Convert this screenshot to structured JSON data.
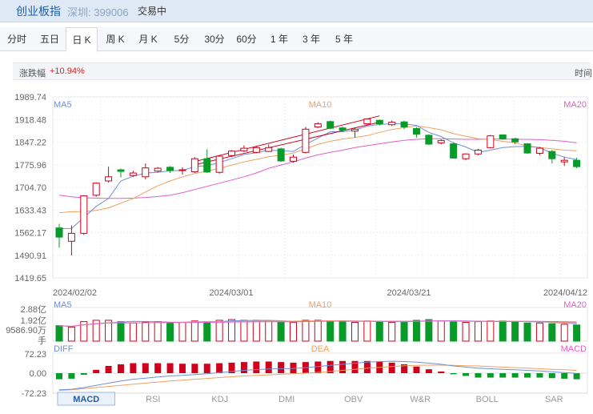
{
  "header": {
    "name": "创业板指",
    "code": "深圳: 399006",
    "status": "交易中"
  },
  "tabs": [
    "分时",
    "五日",
    "日 K",
    "周 K",
    "月 K",
    "5分",
    "30分",
    "60分",
    "1 年",
    "3 年",
    "5 年"
  ],
  "active_tab": "日 K",
  "change": {
    "label": "涨跌幅",
    "value": "+10.94%",
    "time_label": "时间"
  },
  "price_axis": [
    "1989.74",
    "1918.48",
    "1847.22",
    "1775.96",
    "1704.70",
    "1633.43",
    "1562.17",
    "1490.91",
    "1419.65"
  ],
  "date_axis": [
    "2024/02/02",
    "2024/03/01",
    "2024/03/21",
    "2024/04/12"
  ],
  "ma_labels": {
    "ma5": "MA5",
    "ma10": "MA10",
    "ma20": "MA20"
  },
  "volume_axis": [
    "2.88亿",
    "1.92亿",
    "9586.90万",
    "手"
  ],
  "macd_axis": [
    "72.23",
    "0.00",
    "-72.23"
  ],
  "macd_labels": {
    "diff": "DIFF",
    "dea": "DEA",
    "macd": "MACD"
  },
  "bottom_tabs": [
    "MACD",
    "RSI",
    "KDJ",
    "DMI",
    "OBV",
    "W&R",
    "BOLL",
    "SAR"
  ],
  "active_bottom_tab": "MACD",
  "colors": {
    "up": "#d0021b",
    "down": "#0a9a2a",
    "ma5": "#6f8fd8",
    "ma10": "#f0a060",
    "ma20": "#e060c8",
    "accent": "#1f5ea8"
  },
  "chart_data": {
    "type": "candlestick",
    "ylim": [
      1419.65,
      1989.74
    ],
    "candles": [
      {
        "o": 1577,
        "c": 1548,
        "h": 1590,
        "l": 1515
      },
      {
        "o": 1535,
        "c": 1560,
        "h": 1585,
        "l": 1490
      },
      {
        "o": 1560,
        "c": 1678,
        "h": 1680,
        "l": 1555
      },
      {
        "o": 1680,
        "c": 1718,
        "h": 1720,
        "l": 1675
      },
      {
        "o": 1725,
        "c": 1738,
        "h": 1770,
        "l": 1720
      },
      {
        "o": 1760,
        "c": 1755,
        "h": 1764,
        "l": 1736
      },
      {
        "o": 1742,
        "c": 1750,
        "h": 1757,
        "l": 1738
      },
      {
        "o": 1738,
        "c": 1766,
        "h": 1780,
        "l": 1730
      },
      {
        "o": 1756,
        "c": 1765,
        "h": 1769,
        "l": 1752
      },
      {
        "o": 1768,
        "c": 1758,
        "h": 1772,
        "l": 1750
      },
      {
        "o": 1760,
        "c": 1760,
        "h": 1768,
        "l": 1745
      },
      {
        "o": 1754,
        "c": 1795,
        "h": 1800,
        "l": 1750
      },
      {
        "o": 1795,
        "c": 1753,
        "h": 1825,
        "l": 1750
      },
      {
        "o": 1752,
        "c": 1803,
        "h": 1806,
        "l": 1748
      },
      {
        "o": 1805,
        "c": 1819,
        "h": 1822,
        "l": 1800
      },
      {
        "o": 1820,
        "c": 1828,
        "h": 1837,
        "l": 1816
      },
      {
        "o": 1815,
        "c": 1830,
        "h": 1835,
        "l": 1812
      },
      {
        "o": 1818,
        "c": 1830,
        "h": 1840,
        "l": 1816
      },
      {
        "o": 1826,
        "c": 1788,
        "h": 1830,
        "l": 1785
      },
      {
        "o": 1787,
        "c": 1800,
        "h": 1808,
        "l": 1783
      },
      {
        "o": 1815,
        "c": 1888,
        "h": 1895,
        "l": 1812
      },
      {
        "o": 1895,
        "c": 1905,
        "h": 1910,
        "l": 1892
      },
      {
        "o": 1912,
        "c": 1891,
        "h": 1915,
        "l": 1888
      },
      {
        "o": 1892,
        "c": 1885,
        "h": 1896,
        "l": 1880
      },
      {
        "o": 1882,
        "c": 1888,
        "h": 1893,
        "l": 1862
      },
      {
        "o": 1905,
        "c": 1920,
        "h": 1922,
        "l": 1902
      },
      {
        "o": 1916,
        "c": 1905,
        "h": 1918,
        "l": 1900
      },
      {
        "o": 1902,
        "c": 1910,
        "h": 1915,
        "l": 1898
      },
      {
        "o": 1911,
        "c": 1895,
        "h": 1915,
        "l": 1888
      },
      {
        "o": 1890,
        "c": 1872,
        "h": 1894,
        "l": 1862
      },
      {
        "o": 1869,
        "c": 1841,
        "h": 1872,
        "l": 1838
      },
      {
        "o": 1845,
        "c": 1852,
        "h": 1856,
        "l": 1840
      },
      {
        "o": 1842,
        "c": 1797,
        "h": 1846,
        "l": 1795
      },
      {
        "o": 1795,
        "c": 1810,
        "h": 1812,
        "l": 1790
      },
      {
        "o": 1810,
        "c": 1822,
        "h": 1826,
        "l": 1806
      },
      {
        "o": 1830,
        "c": 1867,
        "h": 1870,
        "l": 1828
      },
      {
        "o": 1870,
        "c": 1857,
        "h": 1872,
        "l": 1855
      },
      {
        "o": 1858,
        "c": 1848,
        "h": 1861,
        "l": 1840
      },
      {
        "o": 1842,
        "c": 1813,
        "h": 1844,
        "l": 1810
      },
      {
        "o": 1812,
        "c": 1828,
        "h": 1832,
        "l": 1806
      },
      {
        "o": 1818,
        "c": 1795,
        "h": 1822,
        "l": 1780
      },
      {
        "o": 1785,
        "c": 1790,
        "h": 1800,
        "l": 1772
      },
      {
        "o": 1790,
        "c": 1770,
        "h": 1798,
        "l": 1765
      }
    ],
    "ma5": [
      1575,
      1575,
      1610,
      1645,
      1670,
      1725,
      1740,
      1750,
      1752,
      1757,
      1758,
      1770,
      1773,
      1783,
      1795,
      1808,
      1814,
      1822,
      1820,
      1818,
      1840,
      1860,
      1880,
      1880,
      1885,
      1898,
      1903,
      1905,
      1905,
      1900,
      1878,
      1865,
      1845,
      1832,
      1815,
      1822,
      1830,
      1833,
      1834,
      1830,
      1812,
      1800,
      1792
    ],
    "ma10": [
      1625,
      1628,
      1628,
      1632,
      1640,
      1655,
      1670,
      1690,
      1710,
      1725,
      1738,
      1748,
      1756,
      1765,
      1775,
      1785,
      1793,
      1801,
      1806,
      1813,
      1826,
      1840,
      1850,
      1857,
      1862,
      1868,
      1878,
      1887,
      1893,
      1898,
      1893,
      1886,
      1874,
      1866,
      1858,
      1855,
      1850,
      1845,
      1835,
      1830,
      1826,
      1822,
      1820
    ],
    "ma20": [
      1680,
      1675,
      1672,
      1671,
      1670,
      1670,
      1671,
      1673,
      1676,
      1680,
      1688,
      1698,
      1708,
      1718,
      1728,
      1738,
      1750,
      1765,
      1775,
      1785,
      1797,
      1807,
      1815,
      1822,
      1830,
      1836,
      1842,
      1848,
      1853,
      1856,
      1858,
      1858,
      1857,
      1856,
      1856,
      1857,
      1857,
      1856,
      1856,
      1855,
      1853,
      1850,
      1845
    ],
    "trendlines": [
      {
        "from": [
          11,
          1786
        ],
        "to": [
          26,
          1930
        ]
      },
      {
        "from": [
          11,
          1776
        ],
        "to": [
          26,
          1910
        ]
      }
    ],
    "volume": [
      46,
      42,
      58,
      62,
      62,
      58,
      54,
      56,
      58,
      56,
      56,
      60,
      58,
      62,
      64,
      62,
      62,
      60,
      56,
      56,
      62,
      62,
      60,
      60,
      56,
      60,
      58,
      56,
      58,
      62,
      64,
      60,
      58,
      56,
      58,
      60,
      60,
      58,
      54,
      54,
      52,
      50,
      48
    ],
    "volume_ylim": [
      0,
      100
    ],
    "diff": [
      -60,
      -58,
      -52,
      -44,
      -36,
      -28,
      -22,
      -18,
      -14,
      -10,
      -8,
      -5,
      -2,
      2,
      6,
      10,
      13,
      15,
      16,
      17,
      20,
      24,
      28,
      32,
      36,
      40,
      42,
      43,
      42,
      40,
      36,
      32,
      26,
      22,
      18,
      16,
      14,
      12,
      10,
      8,
      5,
      2,
      -1
    ],
    "dea": [
      -62,
      -60,
      -56,
      -52,
      -48,
      -44,
      -40,
      -36,
      -32,
      -28,
      -25,
      -22,
      -19,
      -16,
      -13,
      -10,
      -8,
      -6,
      -4,
      -2,
      0,
      3,
      6,
      10,
      14,
      18,
      21,
      24,
      27,
      28,
      29,
      29,
      28,
      27,
      26,
      24,
      22,
      20,
      18,
      16,
      14,
      12,
      10
    ],
    "macd": [
      -22,
      -20,
      -6,
      12,
      26,
      32,
      36,
      36,
      36,
      36,
      34,
      34,
      34,
      36,
      38,
      40,
      42,
      42,
      40,
      38,
      40,
      42,
      44,
      44,
      44,
      44,
      42,
      38,
      32,
      24,
      14,
      6,
      -4,
      -10,
      -16,
      -16,
      -16,
      -16,
      -16,
      -16,
      -18,
      -20,
      -22
    ],
    "macd_ylim": [
      -72.23,
      72.23
    ]
  }
}
